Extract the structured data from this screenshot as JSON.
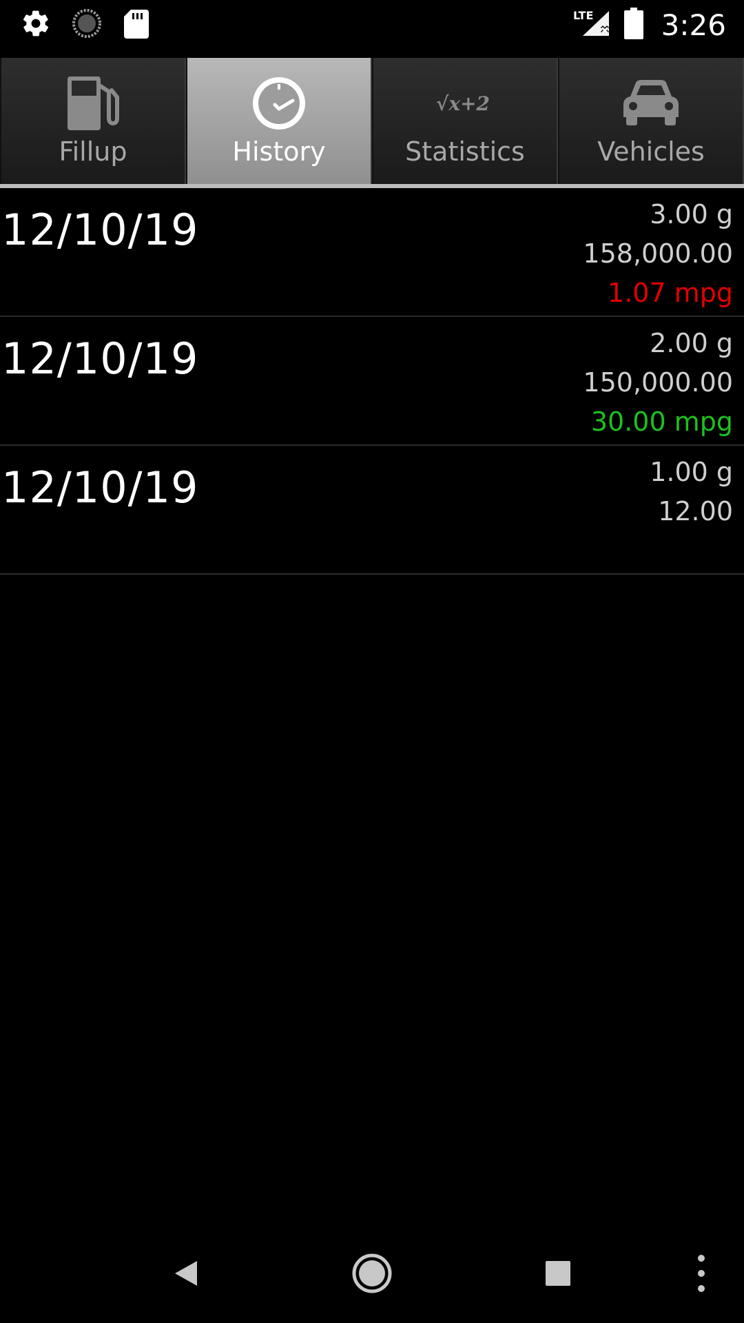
{
  "status_bar": {
    "time": "3:26",
    "network": "LTE",
    "icons": [
      "gear-icon",
      "sync-icon",
      "sd-card-icon",
      "lte-signal-icon",
      "battery-icon"
    ]
  },
  "tabs": [
    {
      "label": "Fillup",
      "icon": "fuel-pump-icon",
      "active": false
    },
    {
      "label": "History",
      "icon": "clock-icon",
      "active": true
    },
    {
      "label": "Statistics",
      "icon": "sqrt-formula-icon",
      "formula": "√x+2",
      "active": false
    },
    {
      "label": "Vehicles",
      "icon": "car-icon",
      "active": false
    }
  ],
  "history": [
    {
      "date": "12/10/19",
      "gallons": "3.00 g",
      "odometer": "158,000.00",
      "economy": "1.07 mpg",
      "economy_color": "#e00000"
    },
    {
      "date": "12/10/19",
      "gallons": "2.00 g",
      "odometer": "150,000.00",
      "economy": "30.00 mpg",
      "economy_color": "#1ec01e"
    },
    {
      "date": "12/10/19",
      "gallons": "1.00 g",
      "odometer": "12.00",
      "economy": "",
      "economy_color": ""
    }
  ],
  "nav": [
    "back-icon",
    "home-icon",
    "recents-icon",
    "overflow-menu-icon"
  ],
  "colors": {
    "accent_active_tab": "#a8a8a8",
    "bad_economy": "#e00000",
    "good_economy": "#1ec01e"
  }
}
